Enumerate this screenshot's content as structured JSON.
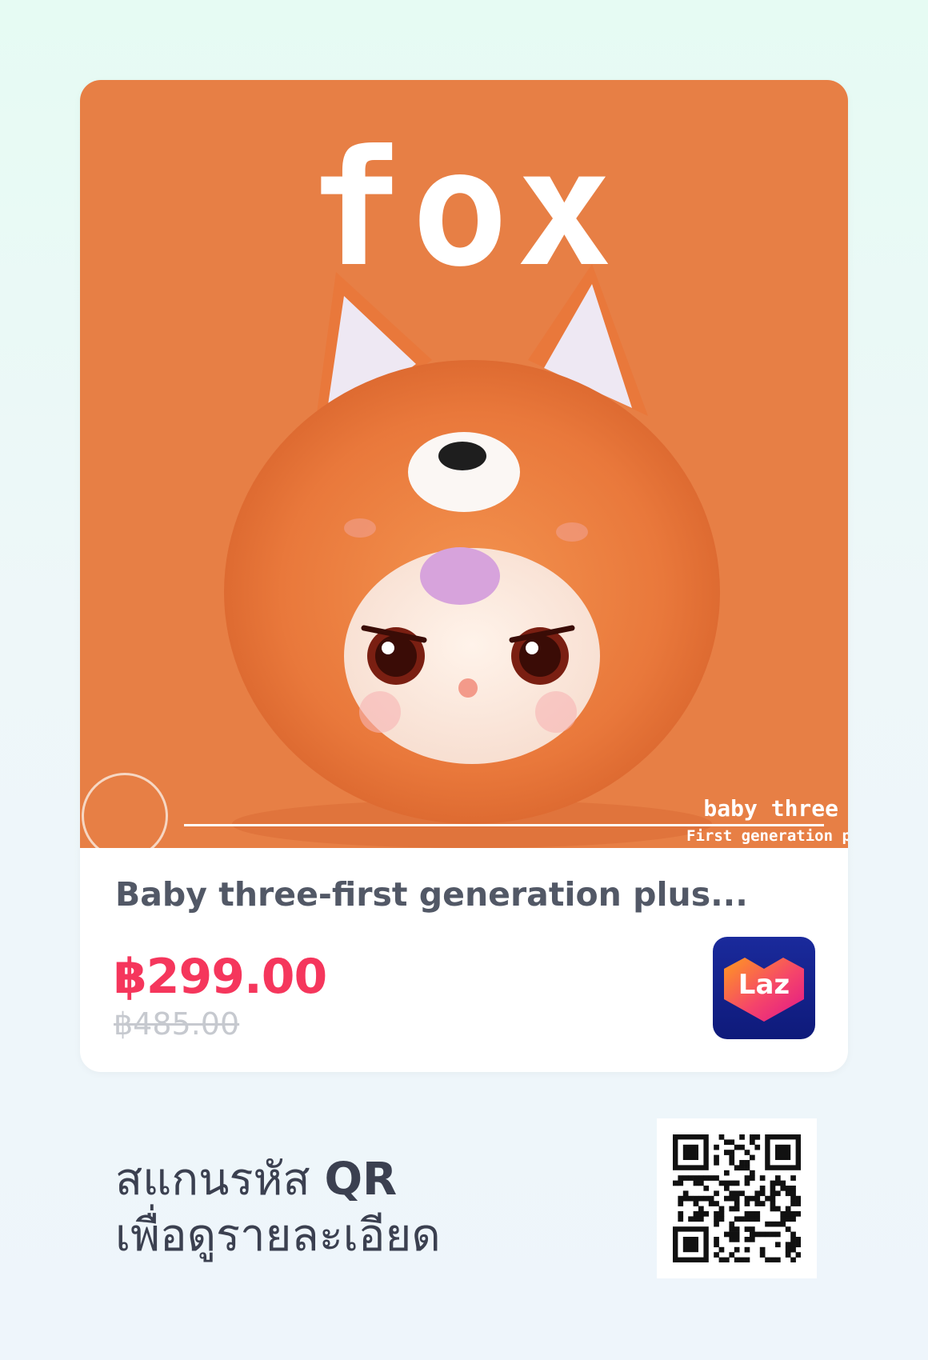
{
  "product": {
    "image_title": "fox",
    "image_brand": "baby three",
    "image_brand_sub": "First generation p",
    "title": "Baby three-first generation plus...",
    "price": "฿299.00",
    "original_price": "฿485.00"
  },
  "store": {
    "logo_text": "Laz"
  },
  "scan": {
    "line1_prefix": "สแกนรหัส",
    "line1_bold": "QR",
    "line2": "เพื่อดูรายละเอียด"
  },
  "colors": {
    "price": "#f5365c",
    "image_background": "#e77f45",
    "laz_background": "#1a2a9c"
  }
}
